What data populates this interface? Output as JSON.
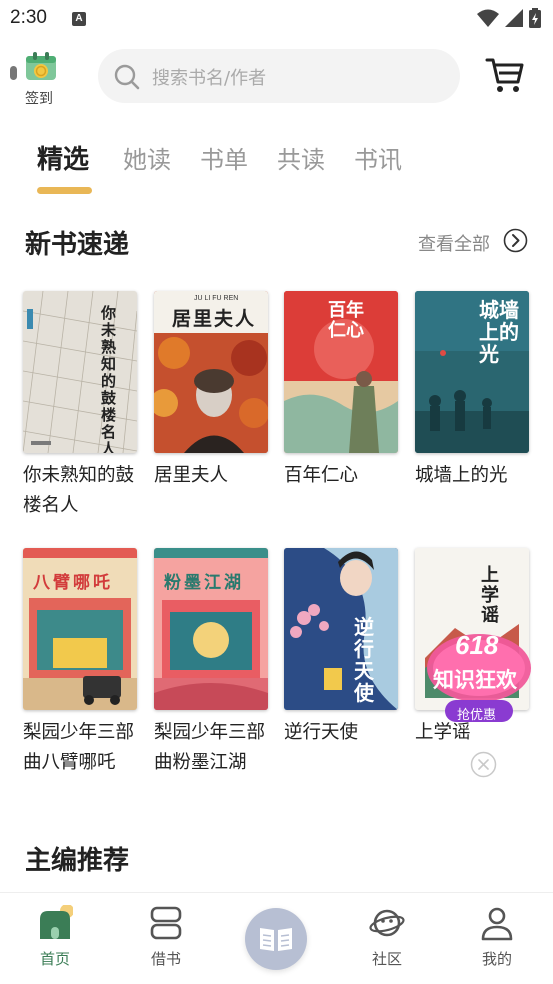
{
  "status_bar": {
    "time": "2:30",
    "notification_badge": "A"
  },
  "header": {
    "signin_label": "签到",
    "search_placeholder": "搜索书名/作者"
  },
  "tabs": [
    {
      "label": "精选",
      "active": true
    },
    {
      "label": "她读",
      "active": false
    },
    {
      "label": "书单",
      "active": false
    },
    {
      "label": "共读",
      "active": false
    },
    {
      "label": "书讯",
      "active": false
    }
  ],
  "new_books": {
    "title": "新书速递",
    "view_all_label": "查看全部",
    "books": [
      {
        "title": "你未熟知的鼓楼名人",
        "cover_text": "你未熟知的鼓楼名人"
      },
      {
        "title": "居里夫人",
        "cover_text": "居里夫人",
        "cover_pinyin": "JU LI FU REN"
      },
      {
        "title": "百年仁心",
        "cover_text": "百年仁心"
      },
      {
        "title": "城墙上的光",
        "cover_text": "城墙上的光"
      },
      {
        "title": "梨园少年三部曲八臂哪吒",
        "cover_text": "八臂哪吒"
      },
      {
        "title": "梨园少年三部曲粉墨江湖",
        "cover_text": "粉墨江湖"
      },
      {
        "title": "逆行天使",
        "cover_text": "逆行天使"
      },
      {
        "title": "上学谣",
        "cover_text": "上学谣"
      }
    ]
  },
  "promo": {
    "line1": "618",
    "line2": "知识狂欢",
    "button": "抢优惠"
  },
  "editor_picks": {
    "title": "主编推荐"
  },
  "bottom_nav": [
    {
      "label": "首页",
      "icon": "home-icon",
      "active": true
    },
    {
      "label": "借书",
      "icon": "borrow-icon",
      "active": false
    },
    {
      "label": "",
      "icon": "book-open-icon",
      "active": false
    },
    {
      "label": "社区",
      "icon": "community-icon",
      "active": false
    },
    {
      "label": "我的",
      "icon": "profile-icon",
      "active": false
    }
  ],
  "colors": {
    "accent": "#e9b756",
    "nav_active": "#3b7d56",
    "center_button": "#b7bfd3"
  }
}
